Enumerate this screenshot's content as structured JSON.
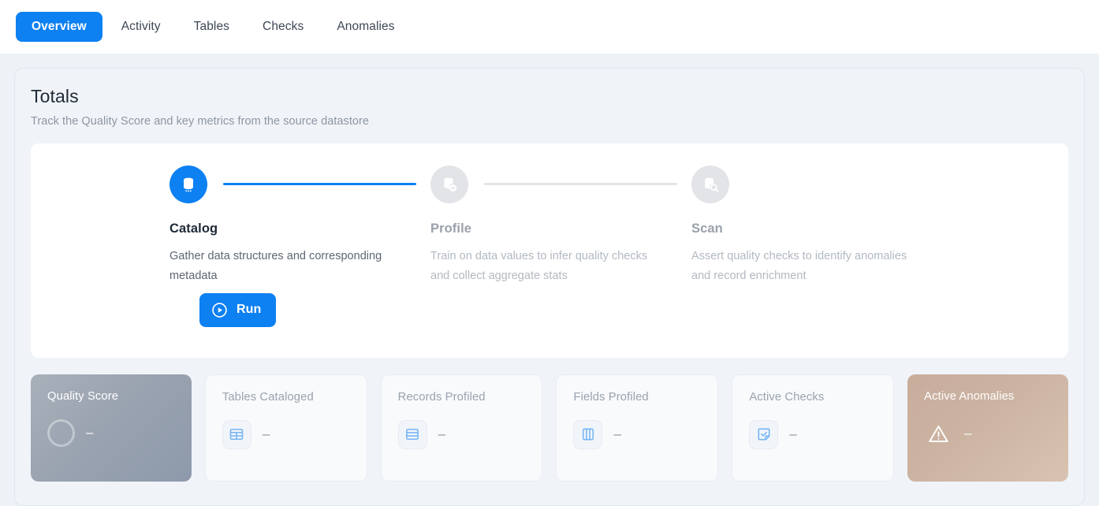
{
  "tabs": [
    {
      "label": "Overview",
      "active": true
    },
    {
      "label": "Activity",
      "active": false
    },
    {
      "label": "Tables",
      "active": false
    },
    {
      "label": "Checks",
      "active": false
    },
    {
      "label": "Anomalies",
      "active": false
    }
  ],
  "panel": {
    "title": "Totals",
    "subtitle": "Track the Quality Score and key metrics from the source datastore"
  },
  "stepper": {
    "steps": [
      {
        "label": "Catalog",
        "description": "Gather data structures and corresponding metadata",
        "icon": "database-icon",
        "state": "done"
      },
      {
        "label": "Profile",
        "description": "Train on data values to infer quality checks and collect aggregate stats",
        "icon": "database-eye-icon",
        "state": "pending"
      },
      {
        "label": "Scan",
        "description": "Assert quality checks to identify anomalies and record enrichment",
        "icon": "database-search-icon",
        "state": "pending"
      }
    ],
    "run_button": {
      "label": "Run",
      "icon": "play-circle-icon"
    }
  },
  "metrics": [
    {
      "label": "Quality Score",
      "value": "–",
      "icon": "gauge-ring-icon",
      "style": "quality"
    },
    {
      "label": "Tables Cataloged",
      "value": "–",
      "icon": "table-grid-icon",
      "style": "plain"
    },
    {
      "label": "Records Profiled",
      "value": "–",
      "icon": "table-rows-icon",
      "style": "plain"
    },
    {
      "label": "Fields Profiled",
      "value": "–",
      "icon": "table-columns-icon",
      "style": "plain"
    },
    {
      "label": "Active Checks",
      "value": "–",
      "icon": "check-note-icon",
      "style": "plain"
    },
    {
      "label": "Active Anomalies",
      "value": "–",
      "icon": "warning-triangle-icon",
      "style": "anomaly"
    }
  ],
  "colors": {
    "accent_blue": "#0d80f2",
    "page_background": "#eef2f6",
    "panel_background": "#f0f4f8",
    "pending_gray": "#e2e4e7",
    "icon_blue": "#76b5f5"
  }
}
